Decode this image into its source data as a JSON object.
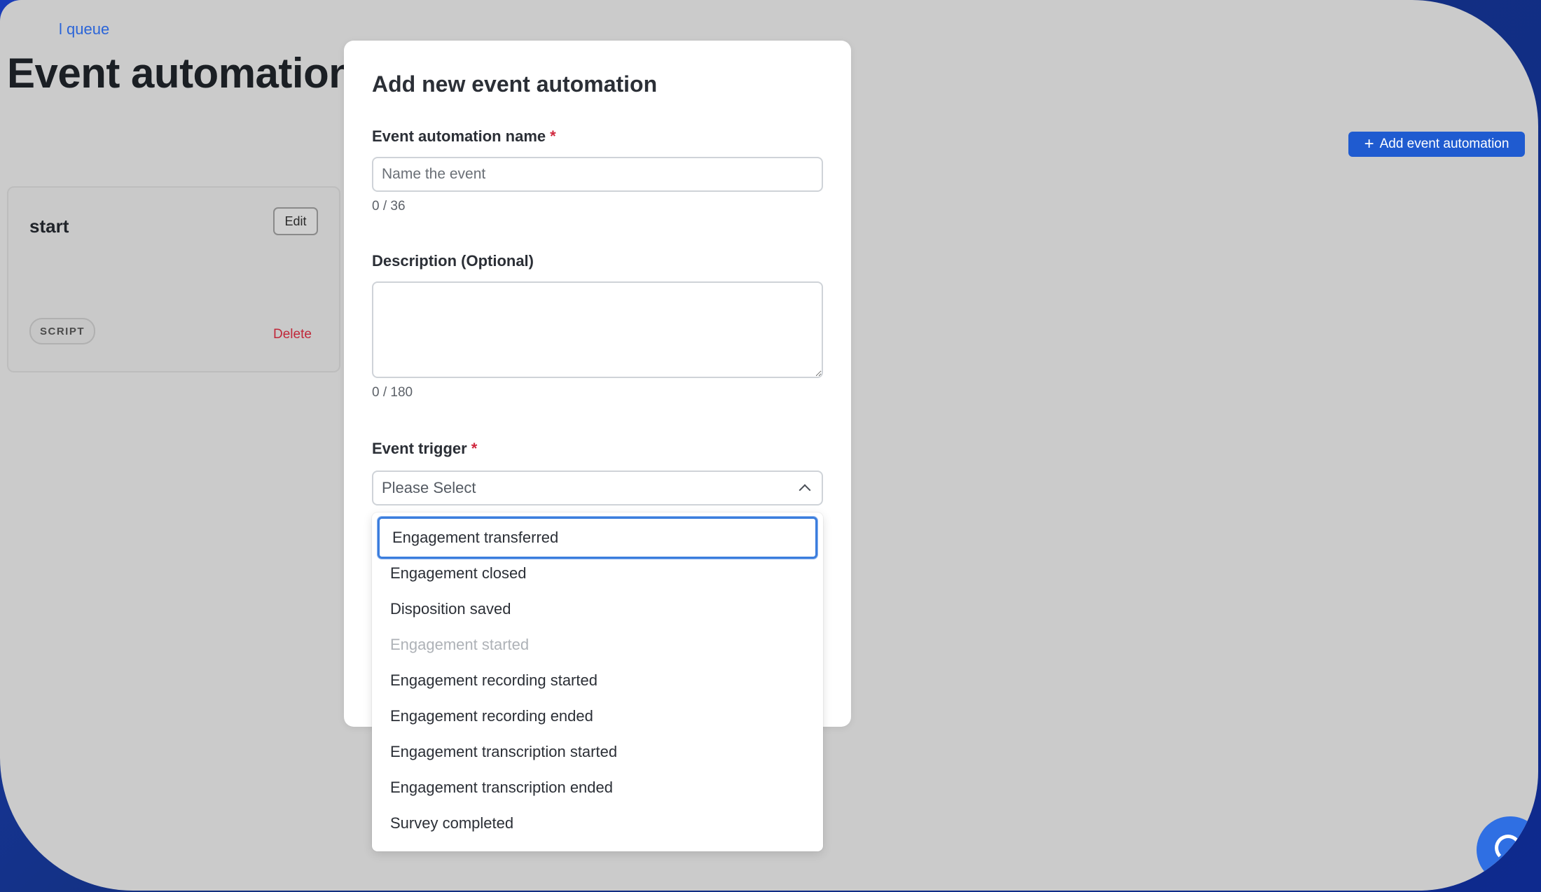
{
  "background": {
    "breadcrumb": "l queue",
    "page_title": "Event automations",
    "add_button_label": "Add event automation",
    "card": {
      "title": "start",
      "edit_label": "Edit",
      "badge": "SCRIPT",
      "delete_label": "Delete"
    }
  },
  "modal": {
    "title": "Add new event automation",
    "name_field": {
      "label": "Event automation name",
      "required_marker": "*",
      "placeholder": "Name the event",
      "value": "",
      "counter": "0 / 36"
    },
    "description_field": {
      "label": "Description (Optional)",
      "value": "",
      "counter": "0 / 180"
    },
    "trigger_field": {
      "label": "Event trigger",
      "required_marker": "*",
      "selected": "Please Select",
      "options": [
        {
          "label": "Engagement transferred",
          "focused": true,
          "disabled": false
        },
        {
          "label": "Engagement closed",
          "focused": false,
          "disabled": false
        },
        {
          "label": "Disposition saved",
          "focused": false,
          "disabled": false
        },
        {
          "label": "Engagement started",
          "focused": false,
          "disabled": true
        },
        {
          "label": "Engagement recording started",
          "focused": false,
          "disabled": false
        },
        {
          "label": "Engagement recording ended",
          "focused": false,
          "disabled": false
        },
        {
          "label": "Engagement transcription started",
          "focused": false,
          "disabled": false
        },
        {
          "label": "Engagement transcription ended",
          "focused": false,
          "disabled": false
        },
        {
          "label": "Survey completed",
          "focused": false,
          "disabled": false
        }
      ]
    }
  },
  "colors": {
    "accent": "#1f5bd0",
    "required": "#d0283e",
    "delete": "#c0283a",
    "focus_ring": "#3b7ddd",
    "overlay": "#cbcbcb"
  },
  "icons": {
    "add": "plus-icon",
    "select": "chevron-up-icon",
    "chat": "chat-bubble-icon"
  }
}
